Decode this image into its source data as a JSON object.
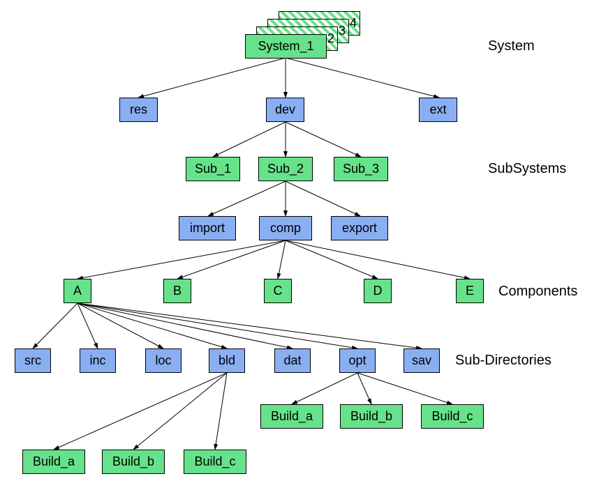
{
  "title_labels": {
    "system": "System",
    "subsystems": "SubSystems",
    "components": "Components",
    "subdirs": "Sub-Directories"
  },
  "systems_bg": [
    "2",
    "3",
    "4"
  ],
  "system_main": "System_1",
  "system_children": {
    "res": "res",
    "dev": "dev",
    "ext": "ext"
  },
  "subsystems": {
    "sub1": "Sub_1",
    "sub2": "Sub_2",
    "sub3": "Sub_3"
  },
  "sub2_children": {
    "import": "import",
    "comp": "comp",
    "export": "export"
  },
  "components": {
    "A": "A",
    "B": "B",
    "C": "C",
    "D": "D",
    "E": "E"
  },
  "subdirs": [
    "src",
    "inc",
    "loc",
    "bld",
    "dat",
    "opt",
    "sav"
  ],
  "bld_builds": [
    "Build_a",
    "Build_b",
    "Build_c"
  ],
  "opt_builds": [
    "Build_a",
    "Build_b",
    "Build_c"
  ]
}
